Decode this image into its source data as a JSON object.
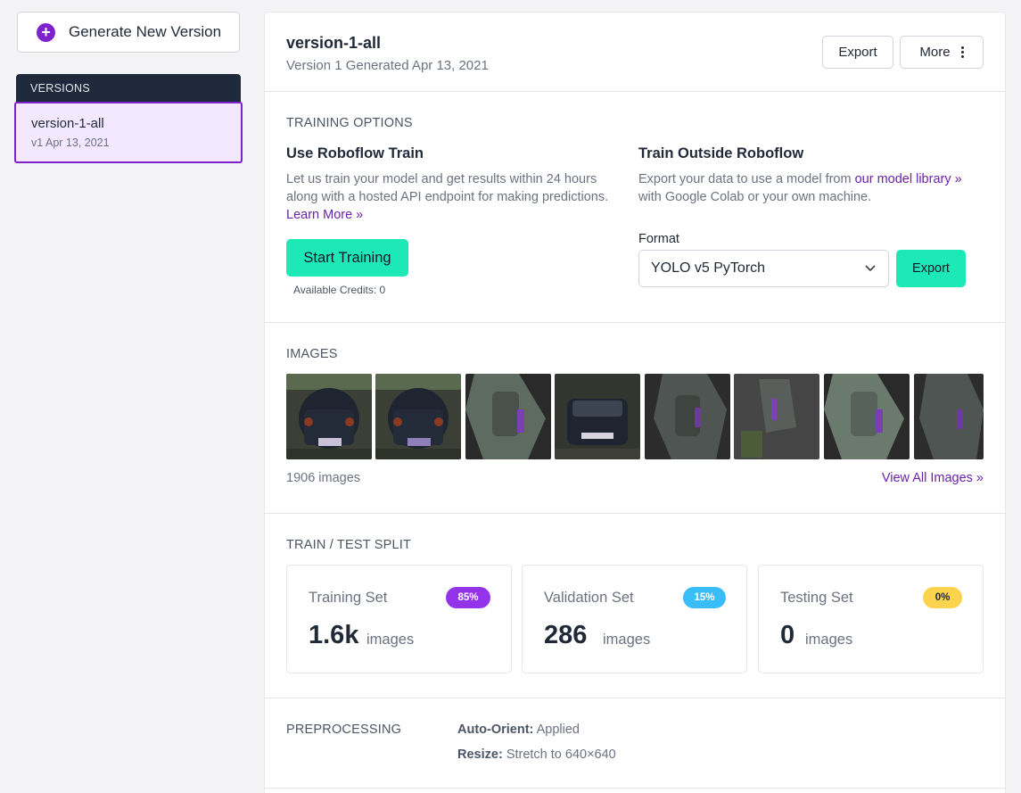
{
  "sidebar": {
    "generate_label": "Generate New Version",
    "versions_header": "VERSIONS",
    "versions": [
      {
        "name": "version-1-all",
        "sub": "v1 Apr 13, 2021"
      }
    ]
  },
  "header": {
    "title": "version-1-all",
    "subtitle": "Version 1 Generated Apr 13, 2021",
    "export_label": "Export",
    "more_label": "More"
  },
  "training": {
    "section_label": "TRAINING OPTIONS",
    "roboflow": {
      "heading": "Use Roboflow Train",
      "desc": "Let us train your model and get results within 24 hours along with a hosted API endpoint for making predictions.",
      "learn_more": "Learn More »",
      "start_label": "Start Training",
      "credits": "Available Credits: 0"
    },
    "outside": {
      "heading": "Train Outside Roboflow",
      "desc_prefix": "Export your data to use a model from",
      "model_link": "our model library »",
      "desc_suffix": "with Google Colab or your own machine.",
      "format_label": "Format",
      "format_value": "YOLO v5 PyTorch",
      "export_label": "Export"
    }
  },
  "images": {
    "section_label": "IMAGES",
    "count": "1906 images",
    "view_all": "View All Images »"
  },
  "split": {
    "section_label": "TRAIN / TEST SPLIT",
    "cards": [
      {
        "title": "Training Set",
        "badge": "85%",
        "value": "1.6k",
        "unit": "images",
        "badge_color": "#9333ea"
      },
      {
        "title": "Validation Set",
        "badge": "15%",
        "value": "286",
        "unit": "images",
        "badge_color": "#38bdf8"
      },
      {
        "title": "Testing Set",
        "badge": "0%",
        "value": "0",
        "unit": "images",
        "badge_color": "#fcd34d"
      }
    ]
  },
  "preprocessing": {
    "section_label": "PREPROCESSING",
    "items": [
      {
        "key": "Auto-Orient:",
        "value": "Applied"
      },
      {
        "key": "Resize:",
        "value": "Stretch to 640×640"
      }
    ]
  },
  "colors": {
    "accent": "#7e22ce",
    "teal": "#1de9b6",
    "sidebar_dark": "#1e293b"
  }
}
